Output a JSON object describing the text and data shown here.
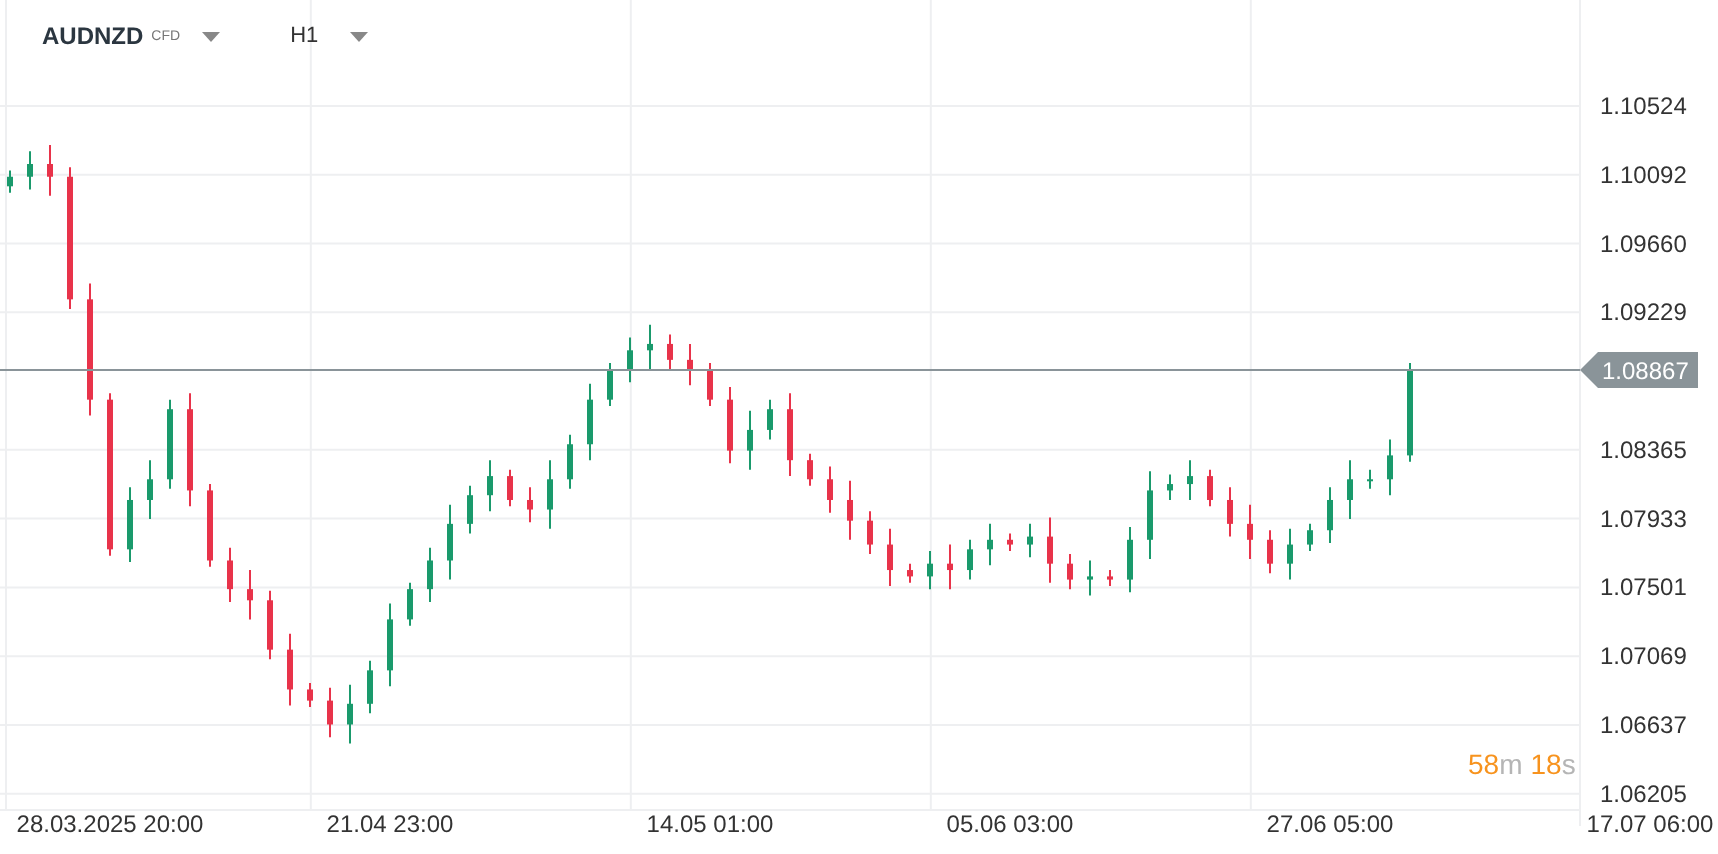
{
  "header": {
    "symbol": "AUDNZD",
    "instrument_type": "CFD",
    "timeframe": "H1"
  },
  "chart": {
    "chart_data": {
      "type": "candlestick",
      "categories": [
        null,
        null,
        null,
        null,
        null,
        "28.03.2025  20:00",
        null,
        null,
        null,
        null,
        null,
        null,
        null,
        null,
        null,
        null,
        null,
        null,
        null,
        "21.04  23:00",
        null,
        null,
        null,
        null,
        null,
        null,
        null,
        null,
        null,
        null,
        null,
        null,
        null,
        null,
        null,
        "14.05  01:00",
        null,
        null,
        null,
        null,
        null,
        null,
        null,
        null,
        null,
        null,
        null,
        null,
        null,
        null,
        "05.06  03:00",
        null,
        null,
        null,
        null,
        null,
        null,
        null,
        null,
        null,
        null,
        null,
        null,
        null,
        null,
        null,
        "27.06  05:00",
        null,
        null,
        null,
        null,
        null,
        null,
        null,
        null,
        null,
        null,
        null,
        null,
        null,
        null,
        null,
        "17.07  06:00"
      ],
      "ohlc": [
        [
          1.1002,
          1.1012,
          1.0998,
          1.1008
        ],
        [
          1.1008,
          1.1024,
          1.1,
          1.1016
        ],
        [
          1.1016,
          1.1028,
          1.0996,
          1.1008
        ],
        [
          1.1008,
          1.1014,
          1.0925,
          1.0931
        ],
        [
          1.0931,
          1.0941,
          1.0858,
          1.0868
        ],
        [
          1.0868,
          1.0872,
          1.077,
          1.0774
        ],
        [
          1.0774,
          1.0813,
          1.0766,
          1.0805
        ],
        [
          1.0805,
          1.083,
          1.0793,
          1.0818
        ],
        [
          1.0818,
          1.0868,
          1.0812,
          1.0862
        ],
        [
          1.0862,
          1.0872,
          1.0801,
          1.0811
        ],
        [
          1.0811,
          1.0815,
          1.0763,
          1.0767
        ],
        [
          1.0767,
          1.0775,
          1.0741,
          1.0749
        ],
        [
          1.0749,
          1.0761,
          1.073,
          1.0742
        ],
        [
          1.0742,
          1.0748,
          1.0705,
          1.0711
        ],
        [
          1.0711,
          1.0721,
          1.0676,
          1.0686
        ],
        [
          1.0686,
          1.069,
          1.0675,
          1.0679
        ],
        [
          1.0679,
          1.0687,
          1.0656,
          1.0664
        ],
        [
          1.0664,
          1.0689,
          1.0652,
          1.0677
        ],
        [
          1.0677,
          1.0704,
          1.0671,
          1.0698
        ],
        [
          1.0698,
          1.074,
          1.0688,
          1.073
        ],
        [
          1.073,
          1.0753,
          1.0726,
          1.0749
        ],
        [
          1.0749,
          1.0775,
          1.0741,
          1.0767
        ],
        [
          1.0767,
          1.0802,
          1.0755,
          1.079
        ],
        [
          1.079,
          1.0814,
          1.0784,
          1.0808
        ],
        [
          1.0808,
          1.083,
          1.0798,
          1.082
        ],
        [
          1.082,
          1.0824,
          1.0801,
          1.0805
        ],
        [
          1.0805,
          1.0813,
          1.0791,
          1.0799
        ],
        [
          1.0799,
          1.083,
          1.0787,
          1.0818
        ],
        [
          1.0818,
          1.0846,
          1.0812,
          1.084
        ],
        [
          1.084,
          1.0878,
          1.083,
          1.0868
        ],
        [
          1.0868,
          1.0891,
          1.0864,
          1.0887
        ],
        [
          1.0887,
          1.0907,
          1.0879,
          1.0899
        ],
        [
          1.0899,
          1.0915,
          1.0887,
          1.0903
        ],
        [
          1.0903,
          1.0909,
          1.0887,
          1.0893
        ],
        [
          1.0893,
          1.0903,
          1.0877,
          1.0887
        ],
        [
          1.0887,
          1.0891,
          1.0864,
          1.0868
        ],
        [
          1.0868,
          1.0876,
          1.0828,
          1.0836
        ],
        [
          1.0836,
          1.0861,
          1.0824,
          1.0849
        ],
        [
          1.0849,
          1.0868,
          1.0843,
          1.0862
        ],
        [
          1.0862,
          1.0872,
          1.082,
          1.083
        ],
        [
          1.083,
          1.0834,
          1.0814,
          1.0818
        ],
        [
          1.0818,
          1.0826,
          1.0797,
          1.0805
        ],
        [
          1.0805,
          1.0817,
          1.078,
          1.0792
        ],
        [
          1.0792,
          1.0798,
          1.0771,
          1.0777
        ],
        [
          1.0777,
          1.0787,
          1.0751,
          1.0761
        ],
        [
          1.0761,
          1.0765,
          1.0753,
          1.0757
        ],
        [
          1.0757,
          1.0773,
          1.0749,
          1.0765
        ],
        [
          1.0765,
          1.0777,
          1.0749,
          1.0761
        ],
        [
          1.0761,
          1.078,
          1.0755,
          1.0774
        ],
        [
          1.0774,
          1.079,
          1.0764,
          1.078
        ],
        [
          1.078,
          1.0784,
          1.0773,
          1.0777
        ],
        [
          1.0777,
          1.079,
          1.0769,
          1.0782
        ],
        [
          1.0782,
          1.0794,
          1.0753,
          1.0765
        ],
        [
          1.0765,
          1.0771,
          1.0749,
          1.0755
        ],
        [
          1.0755,
          1.0767,
          1.0745,
          1.0757
        ],
        [
          1.0757,
          1.0761,
          1.0751,
          1.0755
        ],
        [
          1.0755,
          1.0788,
          1.0747,
          1.078
        ],
        [
          1.078,
          1.0823,
          1.0768,
          1.0811
        ],
        [
          1.0811,
          1.0821,
          1.0805,
          1.0815
        ],
        [
          1.0815,
          1.083,
          1.0805,
          1.082
        ],
        [
          1.082,
          1.0824,
          1.0801,
          1.0805
        ],
        [
          1.0805,
          1.0813,
          1.0782,
          1.079
        ],
        [
          1.079,
          1.0802,
          1.0768,
          1.078
        ],
        [
          1.078,
          1.0786,
          1.0759,
          1.0765
        ],
        [
          1.0765,
          1.0787,
          1.0755,
          1.0777
        ],
        [
          1.0777,
          1.079,
          1.0773,
          1.0786
        ],
        [
          1.0786,
          1.0813,
          1.0778,
          1.0805
        ],
        [
          1.0805,
          1.083,
          1.0793,
          1.0818
        ],
        [
          1.0818,
          1.0824,
          1.0812,
          1.0818
        ],
        [
          1.0818,
          1.0843,
          1.0808,
          1.0833
        ],
        [
          1.0833,
          1.0891,
          1.0829,
          1.0887
        ],
        null,
        null,
        null,
        null,
        null,
        null,
        null,
        null,
        null,
        null,
        null,
        null
      ],
      "ylim": [
        1.06103,
        1.1119
      ],
      "grid": true,
      "ref_lines": [
        {
          "axis": "y",
          "value": 1.08867,
          "label": "1.08867",
          "color": "#8a9499"
        }
      ],
      "yticks": [
        {
          "value": 1.10524,
          "label": "1.10524"
        },
        {
          "value": 1.10092,
          "label": "1.10092"
        },
        {
          "value": 1.0966,
          "label": "1.09660"
        },
        {
          "value": 1.09229,
          "label": "1.09229"
        },
        {
          "value": 1.08365,
          "label": "1.08365"
        },
        {
          "value": 1.07933,
          "label": "1.07933"
        },
        {
          "value": 1.07501,
          "label": "1.07501"
        },
        {
          "value": 1.07069,
          "label": "1.07069"
        },
        {
          "value": 1.06637,
          "label": "1.06637"
        },
        {
          "value": 1.06205,
          "label": "1.06205"
        }
      ]
    },
    "countdown": [
      {
        "text": "58",
        "kind": "number"
      },
      {
        "text": "m",
        "kind": "unit"
      },
      {
        "text": "18",
        "kind": "number"
      },
      {
        "text": "s",
        "kind": "unit"
      }
    ]
  }
}
